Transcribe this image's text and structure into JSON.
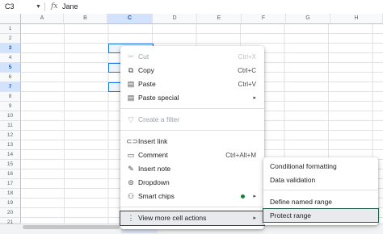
{
  "formula_bar": {
    "cell_ref": "C3",
    "fx_label": "fx",
    "value": "Jane"
  },
  "columns": [
    "A",
    "B",
    "C",
    "D",
    "E",
    "F",
    "G",
    "H"
  ],
  "selected_column": "C",
  "rows": [
    "1",
    "2",
    "3",
    "4",
    "5",
    "6",
    "7",
    "8",
    "9",
    "10",
    "11",
    "12",
    "13",
    "14",
    "15",
    "16",
    "17",
    "18",
    "19",
    "20",
    "21"
  ],
  "selected_rows": [
    "3",
    "5",
    "7"
  ],
  "context_menu": {
    "items": [
      {
        "label": "Cut",
        "shortcut": "Ctrl+X",
        "icon": "scissors-icon",
        "disabled": true
      },
      {
        "label": "Copy",
        "shortcut": "Ctrl+C",
        "icon": "copy-icon"
      },
      {
        "label": "Paste",
        "shortcut": "Ctrl+V",
        "icon": "paste-icon"
      },
      {
        "label": "Paste special",
        "icon": "paste-special-icon",
        "submenu": true
      },
      {
        "label": "Create a filter",
        "icon": "filter-icon",
        "disabled": true
      },
      {
        "label": "Insert link",
        "icon": "link-icon"
      },
      {
        "label": "Comment",
        "shortcut": "Ctrl+Alt+M",
        "icon": "comment-icon"
      },
      {
        "label": "Insert note",
        "icon": "note-icon"
      },
      {
        "label": "Dropdown",
        "icon": "dropdown-icon"
      },
      {
        "label": "Smart chips",
        "icon": "smart-chips-icon",
        "submenu": true,
        "badge_color": "#188038"
      },
      {
        "label": "View more cell actions",
        "icon": "more-vert-icon",
        "submenu": true,
        "highlighted": true
      }
    ],
    "submenu_arrow": "▸"
  },
  "submenu": {
    "items": [
      {
        "label": "Conditional formatting"
      },
      {
        "label": "Data validation"
      },
      {
        "label": "Define named range"
      },
      {
        "label": "Protect range",
        "highlighted": true
      }
    ]
  }
}
